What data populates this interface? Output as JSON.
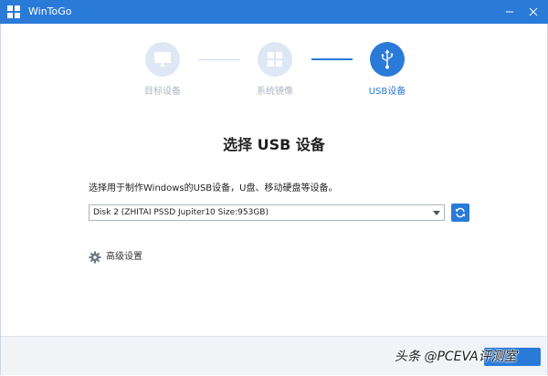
{
  "window": {
    "title": "WinToGo"
  },
  "steps": [
    {
      "label": "目标设备",
      "state": "done",
      "icon": "monitor-icon"
    },
    {
      "label": "系统镜像",
      "state": "done",
      "icon": "windows-logo-icon"
    },
    {
      "label": "USB设备",
      "state": "active",
      "icon": "usb-icon"
    }
  ],
  "main": {
    "heading": "选择 USB 设备",
    "prompt": "选择用于制作Windows的USB设备，U盘、移动硬盘等设备。",
    "device_select": {
      "selected": "Disk 2 (ZHITAI  PSSD Jupiter10   Size:953GB)"
    },
    "advanced_label": "高级设置"
  },
  "watermark": "头条 @PCEVA评测室",
  "colors": {
    "accent": "#2a7ad8",
    "inactive_step_bg": "#dde8f4",
    "inactive_step_text": "#a8b6c6",
    "footer_bg": "#f1f3f6"
  }
}
